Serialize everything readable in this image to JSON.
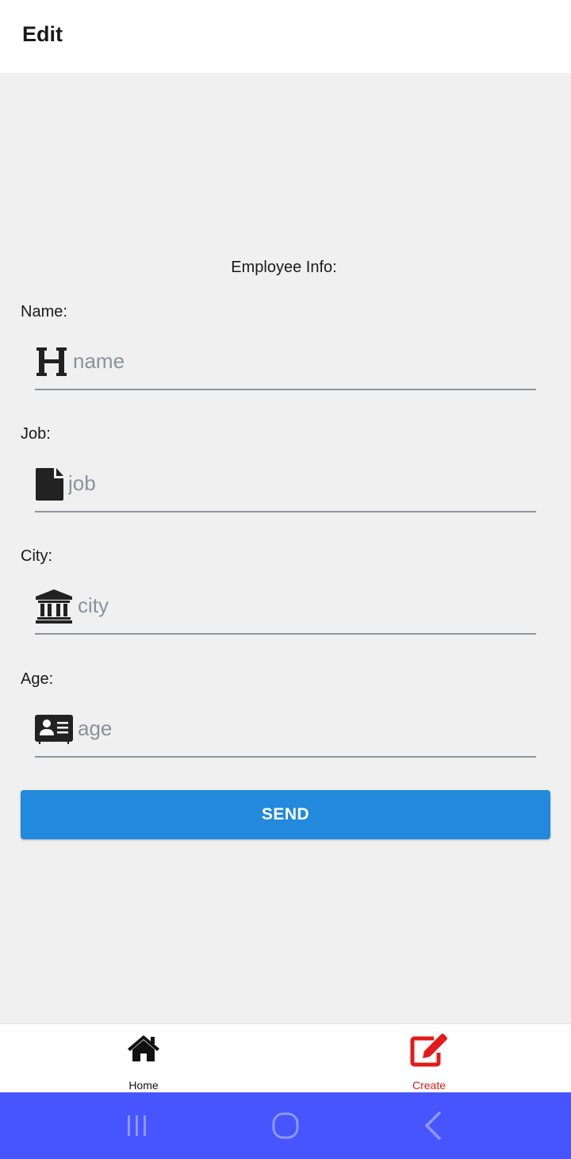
{
  "header": {
    "title": "Edit"
  },
  "form": {
    "section_title": "Employee Info:",
    "fields": [
      {
        "label": "Name:",
        "placeholder": "name",
        "icon": "heading-icon"
      },
      {
        "label": "Job:",
        "placeholder": "job",
        "icon": "file-icon"
      },
      {
        "label": "City:",
        "placeholder": "city",
        "icon": "bank-icon"
      },
      {
        "label": "Age:",
        "placeholder": "age",
        "icon": "id-card-icon"
      }
    ],
    "submit_label": "SEND"
  },
  "tabbar": {
    "tabs": [
      {
        "label": "Home",
        "icon": "home-icon",
        "active": false
      },
      {
        "label": "Create",
        "icon": "edit-icon",
        "active": true
      }
    ],
    "active_color": "#e41a1a",
    "inactive_color": "#111111"
  },
  "system_nav": {
    "buttons": [
      "recents-icon",
      "home-circle-icon",
      "back-icon"
    ],
    "background": "#4655fd"
  },
  "colors": {
    "accent": "#2289dc",
    "background": "#f0f0f0"
  }
}
